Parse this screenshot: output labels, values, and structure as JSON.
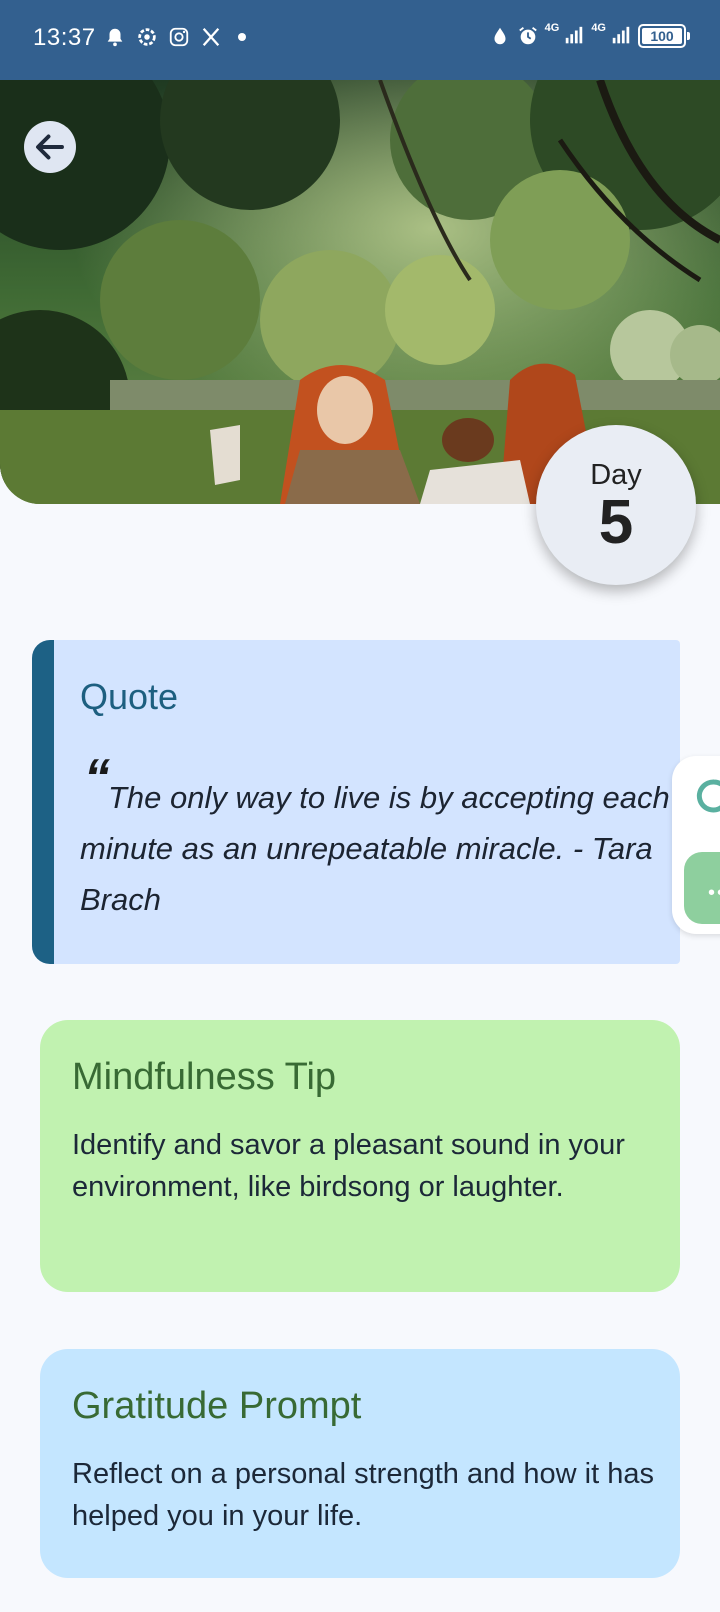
{
  "status_bar": {
    "time": "13:37",
    "left_icons": [
      "alarm-bell-icon",
      "settings-gear-icon",
      "instagram-icon",
      "x-icon",
      "dot-icon"
    ],
    "right_icons": [
      "water-drop-icon",
      "alarm-clock-icon",
      "signal-4g-icon",
      "signal-4g-icon",
      "battery-icon"
    ],
    "network_label_1": "4G",
    "network_label_2": "4G",
    "battery": "100"
  },
  "hero": {
    "back_icon": "arrow-left-icon",
    "day_label": "Day",
    "day_number": "5"
  },
  "quote_card": {
    "title": "Quote",
    "quote_mark": "“",
    "text": "The only way to live is by accepting each minute as an unrepeatable miracle. - Tara Brach"
  },
  "tip_card": {
    "title": "Mindfulness Tip",
    "body": "Identify and savor a pleasant sound in your environment, like birdsong or laughter."
  },
  "gratitude_card": {
    "title": "Gratitude Prompt",
    "body": "Reflect on a personal strength and how it has helped you in your life."
  },
  "side_widget": {
    "chat_icon": "chat-bubble-icon",
    "more_icon": "more-dots-icon",
    "more_glyph": "••"
  },
  "colors": {
    "status_bar": "#33608f",
    "quote_bg": "#d3e4ff",
    "quote_accent": "#1d6185",
    "tip_bg": "#c1f2b0",
    "gratitude_bg": "#c4e6ff",
    "title_green": "#386a34"
  }
}
